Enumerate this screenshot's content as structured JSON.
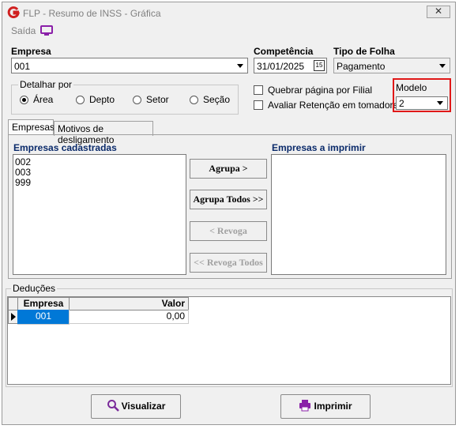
{
  "window": {
    "title": "FLP - Resumo de INSS - Gráfica",
    "close_label": "✕"
  },
  "menu": {
    "saida_label": "Saída"
  },
  "empresa": {
    "label": "Empresa",
    "value": "001"
  },
  "competencia": {
    "label": "Competência",
    "value": "31/01/2025",
    "calendar_label": "15"
  },
  "tipo_folha": {
    "label": "Tipo de Folha",
    "value": "Pagamento"
  },
  "detalhar": {
    "title": "Detalhar por",
    "options": [
      "Área",
      "Depto",
      "Setor",
      "Seção"
    ],
    "selected": "Área"
  },
  "options": {
    "quebrar_label": "Quebrar página por Filial",
    "avaliar_label": "Avaliar Retenção em tomadores"
  },
  "modelo": {
    "label": "Modelo",
    "value": "2"
  },
  "tabs": [
    {
      "label": "Empresas",
      "active": true
    },
    {
      "label": "Motivos de desligamento",
      "active": false
    }
  ],
  "empresas_cadastradas": {
    "title": "Empresas cadastradas",
    "items": [
      "002",
      "003",
      "999"
    ]
  },
  "empresas_imprimir": {
    "title": "Empresas a imprimir",
    "items": []
  },
  "buttons": {
    "agrupa": "Agrupa >",
    "agrupa_todos": "Agrupa Todos >>",
    "revoga": "< Revoga",
    "revoga_todos": "<< Revoga Todos",
    "visualizar": "Visualizar",
    "imprimir": "Imprimir"
  },
  "deducoes": {
    "title": "Deduções",
    "columns": [
      "Empresa",
      "Valor"
    ],
    "rows": [
      {
        "empresa": "001",
        "valor": "0,00"
      }
    ]
  },
  "colors": {
    "accent_red": "#e01818",
    "selected_blue": "#0078d7",
    "header_blue": "#0a2a6a",
    "icon_purple": "#8a1fa8"
  }
}
